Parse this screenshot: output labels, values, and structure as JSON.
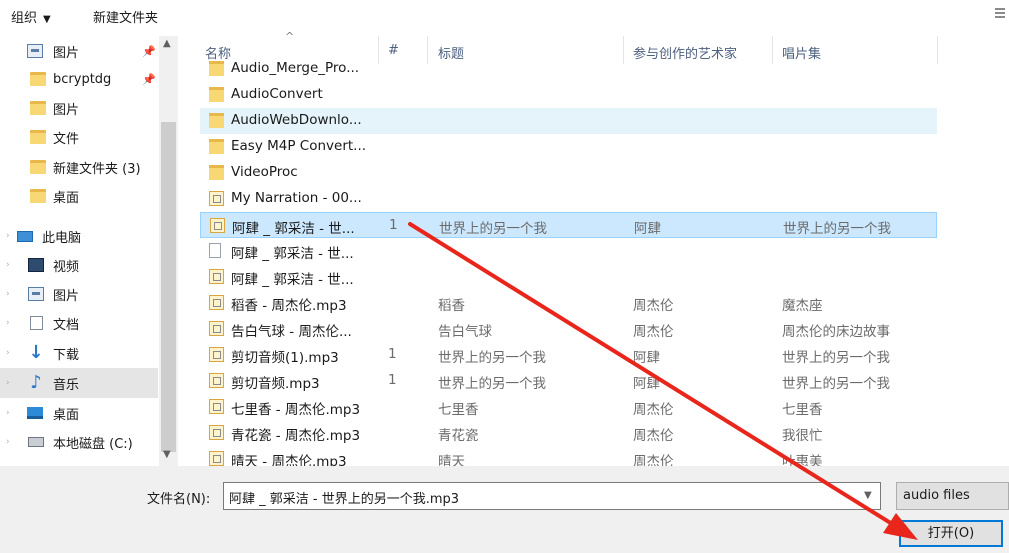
{
  "toolbar": {
    "organize_label": "组织",
    "organize_caret": "▼",
    "new_folder_label": "新建文件夹"
  },
  "nav": {
    "items": [
      {
        "label": "图片",
        "icon": "pictures-icon",
        "pinned": true
      },
      {
        "label": "bcryptdg",
        "icon": "folder-icon",
        "pinned": true
      },
      {
        "label": "图片",
        "icon": "folder-icon",
        "pinned": false
      },
      {
        "label": "文件",
        "icon": "folder-icon",
        "pinned": false
      },
      {
        "label": "新建文件夹 (3)",
        "icon": "folder-icon",
        "pinned": false
      },
      {
        "label": "桌面",
        "icon": "folder-icon",
        "pinned": false
      },
      {
        "label": "此电脑",
        "icon": "this-pc-icon",
        "pinned": false
      },
      {
        "label": "视频",
        "icon": "videos-icon",
        "pinned": false
      },
      {
        "label": "图片",
        "icon": "pictures-icon",
        "pinned": false
      },
      {
        "label": "文档",
        "icon": "documents-icon",
        "pinned": false
      },
      {
        "label": "下载",
        "icon": "downloads-icon",
        "pinned": false
      },
      {
        "label": "音乐",
        "icon": "music-icon",
        "pinned": false
      },
      {
        "label": "桌面",
        "icon": "desktop-icon",
        "pinned": false
      },
      {
        "label": "本地磁盘 (C:)",
        "icon": "drive-icon",
        "pinned": false
      }
    ]
  },
  "list": {
    "columns": {
      "name": "名称",
      "number": "#",
      "title": "标题",
      "artists": "参与创作的艺术家",
      "album": "唱片集"
    },
    "rows": [
      {
        "name": "Audio_Merge_Pro...",
        "number": "",
        "title": "",
        "artist": "",
        "album": "",
        "type": "folder"
      },
      {
        "name": "AudioConvert",
        "number": "",
        "title": "",
        "artist": "",
        "album": "",
        "type": "folder"
      },
      {
        "name": "AudioWebDownlo...",
        "number": "",
        "title": "",
        "artist": "",
        "album": "",
        "type": "folder"
      },
      {
        "name": "Easy M4P Convert...",
        "number": "",
        "title": "",
        "artist": "",
        "album": "",
        "type": "folder"
      },
      {
        "name": "VideoProc",
        "number": "",
        "title": "",
        "artist": "",
        "album": "",
        "type": "folder"
      },
      {
        "name": "My Narration - 00...",
        "number": "",
        "title": "",
        "artist": "",
        "album": "",
        "type": "audio"
      },
      {
        "name": "阿肆 _ 郭采洁 - 世...",
        "number": "1",
        "title": "世界上的另一个我",
        "artist": "阿肆",
        "album": "世界上的另一个我",
        "type": "audio"
      },
      {
        "name": "阿肆 _ 郭采洁 - 世...",
        "number": "",
        "title": "",
        "artist": "",
        "album": "",
        "type": "blank"
      },
      {
        "name": "阿肆 _ 郭采洁 - 世...",
        "number": "",
        "title": "",
        "artist": "",
        "album": "",
        "type": "audio"
      },
      {
        "name": "稻香 - 周杰伦.mp3",
        "number": "",
        "title": "稻香",
        "artist": "周杰伦",
        "album": "魔杰座",
        "type": "audio"
      },
      {
        "name": "告白气球 - 周杰伦...",
        "number": "",
        "title": "告白气球",
        "artist": "周杰伦",
        "album": "周杰伦的床边故事",
        "type": "audio"
      },
      {
        "name": "剪切音频(1).mp3",
        "number": "1",
        "title": "世界上的另一个我",
        "artist": "阿肆",
        "album": "世界上的另一个我",
        "type": "audio"
      },
      {
        "name": "剪切音频.mp3",
        "number": "1",
        "title": "世界上的另一个我",
        "artist": "阿肆",
        "album": "世界上的另一个我",
        "type": "audio"
      },
      {
        "name": "七里香 - 周杰伦.mp3",
        "number": "",
        "title": "七里香",
        "artist": "周杰伦",
        "album": "七里香",
        "type": "audio"
      },
      {
        "name": "青花瓷 - 周杰伦.mp3",
        "number": "",
        "title": "青花瓷",
        "artist": "周杰伦",
        "album": "我很忙",
        "type": "audio"
      },
      {
        "name": "晴天 - 周杰伦.mp3",
        "number": "",
        "title": "晴天",
        "artist": "周杰伦",
        "album": "叶惠美",
        "type": "audio"
      }
    ]
  },
  "bottom": {
    "filename_label": "文件名(N):",
    "filename_value": "阿肆 _ 郭采洁 - 世界上的另一个我.mp3",
    "filter_label": "audio files",
    "open_label": "打开(O)"
  },
  "colors": {
    "selection": "#cce8ff",
    "hover": "#e5f3fb",
    "annotation_arrow": "#e8261c",
    "open_button_border": "#0078d7"
  }
}
